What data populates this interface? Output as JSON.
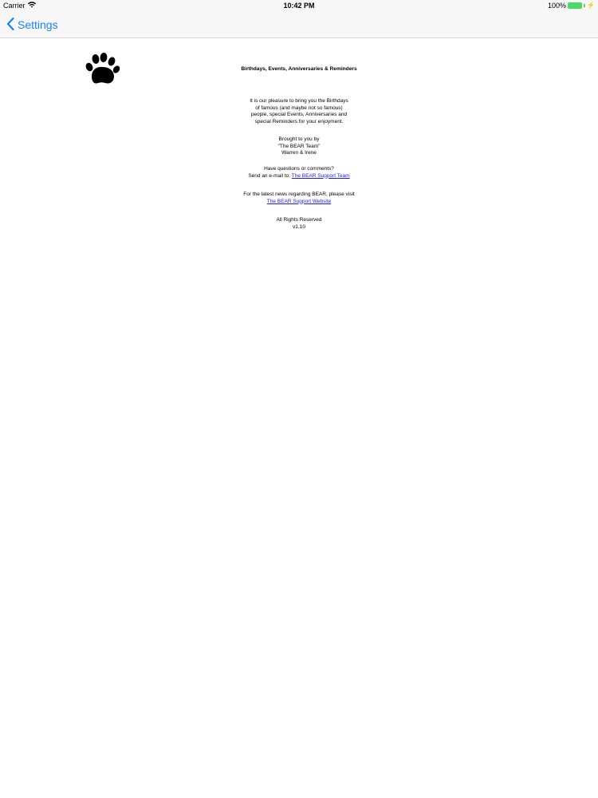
{
  "status_bar": {
    "carrier": "Carrier",
    "time": "10:42 PM",
    "battery_percent": "100%",
    "battery_level": 1.0,
    "battery_color": "#4cd964"
  },
  "nav": {
    "back_label": "Settings",
    "accent_color": "#1a82fb"
  },
  "about": {
    "logo_icon": "bear-paw-icon",
    "title": "Birthdays, Events, Anniversaries & Reminders",
    "intro_lines": [
      "It is our pleasure to bring you the Birthdays",
      "of famous (and maybe not so famous)",
      "people, special Events, Anniversaries and",
      "special Reminders for your enjoyment."
    ],
    "credits_lines": [
      "Brought to you by",
      "\"The BEAR Team\"",
      "Warren & Irene"
    ],
    "contact_question": "Have questions or comments?",
    "contact_prefix": "Send an e-mail to:",
    "contact_link": "The BEAR Support Team",
    "news_text": "For the latest news regarding BEAR, please visit",
    "news_link": "The BEAR Support Website",
    "rights": "All Rights Reserved",
    "version": "v1.10"
  }
}
